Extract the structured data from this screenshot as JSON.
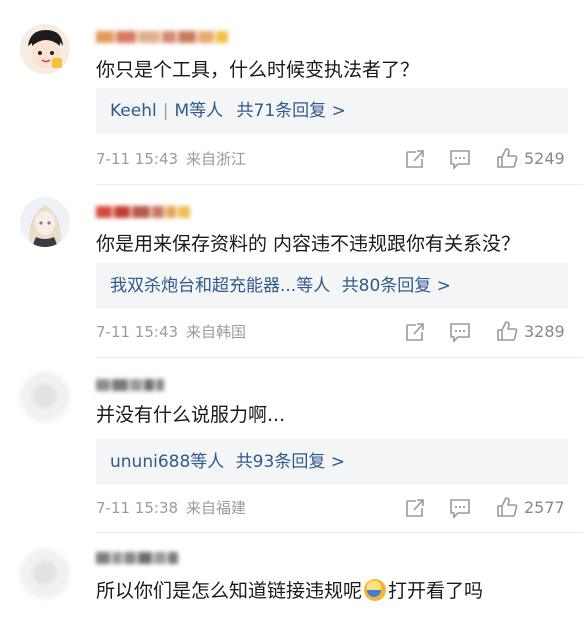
{
  "comments": [
    {
      "text": "你只是个工具，什么时候变执法者了？",
      "reply": {
        "names": "Keehl",
        "names2": "M等人",
        "sep": "|",
        "total": "共71条回复 >"
      },
      "date": "7-11 15:43",
      "source": "来自浙江",
      "likes": "5249",
      "avatar": "cartoon-face"
    },
    {
      "text": "你是用来保存资料的 内容违不违规跟你有关系没？",
      "reply": {
        "names": "我双杀炮台和超充能器...等人",
        "total": "共80条回复 >"
      },
      "date": "7-11 15:43",
      "source": "来自韩国",
      "likes": "3289",
      "avatar": "anime-girl"
    },
    {
      "text": "并没有什么说服力啊...",
      "reply": {
        "names": "ununi688等人",
        "total": "共93条回复 >"
      },
      "date": "7-11 15:38",
      "source": "来自福建",
      "likes": "2577",
      "avatar": "blurred"
    },
    {
      "text": "所以你们是怎么知道链接违规呢",
      "text_after_emoji": "打开看了吗",
      "avatar": "blurred"
    }
  ],
  "icons": {
    "share": "share-icon",
    "comment": "comment-icon",
    "like": "thumbs-up-icon",
    "emoji": "crying-laugh-emoji"
  },
  "colors": {
    "link": "#2f5b8a",
    "meta": "#9b9b9b",
    "reply_bg": "#f4f5f7"
  }
}
